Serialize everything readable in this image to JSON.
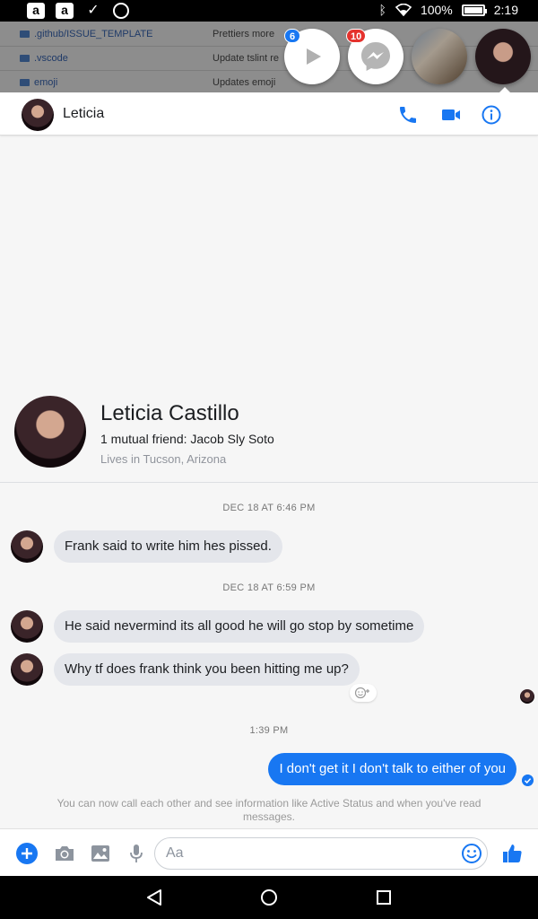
{
  "status_bar": {
    "app_icon_1": "a",
    "app_icon_2": "a",
    "battery": "100%",
    "battery_level": 1.0,
    "time": "2:19"
  },
  "background_repo": {
    "rows": [
      {
        "name": ".github/ISSUE_TEMPLATE",
        "message": "Prettiers more"
      },
      {
        "name": ".vscode",
        "message": "Update tslint re"
      },
      {
        "name": "emoji",
        "message": "Updates emoji"
      }
    ]
  },
  "chat_heads": {
    "play_badge": "6",
    "messenger_badge": "10"
  },
  "header": {
    "name": "Leticia"
  },
  "profile": {
    "full_name": "Leticia Castillo",
    "mutual": "1 mutual friend: Jacob Sly Soto",
    "lives": "Lives in Tucson, Arizona"
  },
  "conversation": {
    "timestamp_1": "DEC 18 AT 6:46 PM",
    "message_1": "Frank said to write him hes pissed.",
    "timestamp_2": "DEC 18 AT 6:59 PM",
    "message_2": "He said nevermind its all good he will go stop by sometime",
    "message_3": "Why tf does frank think you been hitting me up?",
    "timestamp_3": "1:39 PM",
    "message_out": "I don't get it I don't talk to either of you",
    "system_note": "You can now call each other and see information like Active Status and when you've read messages."
  },
  "composer": {
    "placeholder": "Aa"
  },
  "colors": {
    "accent": "#1877f2",
    "badge_red": "#e5322d",
    "incoming_bubble": "#e4e6eb"
  },
  "icons": [
    "amazon-icon",
    "checkmark-icon",
    "messenger-icon",
    "bluetooth-icon",
    "wifi-icon",
    "battery-icon",
    "play-icon",
    "phone-icon",
    "video-icon",
    "info-icon",
    "plus-icon",
    "camera-icon",
    "image-icon",
    "microphone-icon",
    "emoji-icon",
    "thumbs-up-icon",
    "back-icon",
    "home-icon",
    "recent-apps-icon"
  ]
}
